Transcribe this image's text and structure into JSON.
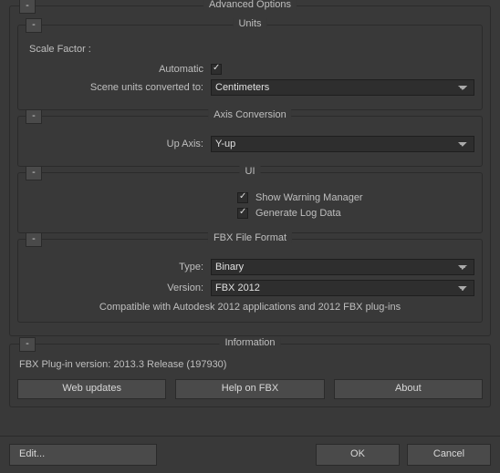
{
  "advanced": {
    "title": "Advanced Options",
    "collapse": "-",
    "units": {
      "title": "Units",
      "collapse": "-",
      "scale_factor_label": "Scale Factor :",
      "automatic_label": "Automatic",
      "automatic_checked": true,
      "converted_label": "Scene units converted to:",
      "converted_value": "Centimeters"
    },
    "axis": {
      "title": "Axis Conversion",
      "collapse": "-",
      "up_axis_label": "Up Axis:",
      "up_axis_value": "Y-up"
    },
    "ui": {
      "title": "UI",
      "collapse": "-",
      "show_warning_label": "Show Warning Manager",
      "show_warning_checked": true,
      "generate_log_label": "Generate Log Data",
      "generate_log_checked": true
    },
    "fbx": {
      "title": "FBX File Format",
      "collapse": "-",
      "type_label": "Type:",
      "type_value": "Binary",
      "version_label": "Version:",
      "version_value": "FBX 2012",
      "note": "Compatible with Autodesk 2012 applications and 2012 FBX plug-ins"
    }
  },
  "information": {
    "title": "Information",
    "collapse": "-",
    "plugin_version": "FBX Plug-in version: 2013.3 Release (197930)",
    "web_updates": "Web updates",
    "help": "Help on FBX",
    "about": "About"
  },
  "bottom": {
    "edit": "Edit...",
    "ok": "OK",
    "cancel": "Cancel"
  }
}
